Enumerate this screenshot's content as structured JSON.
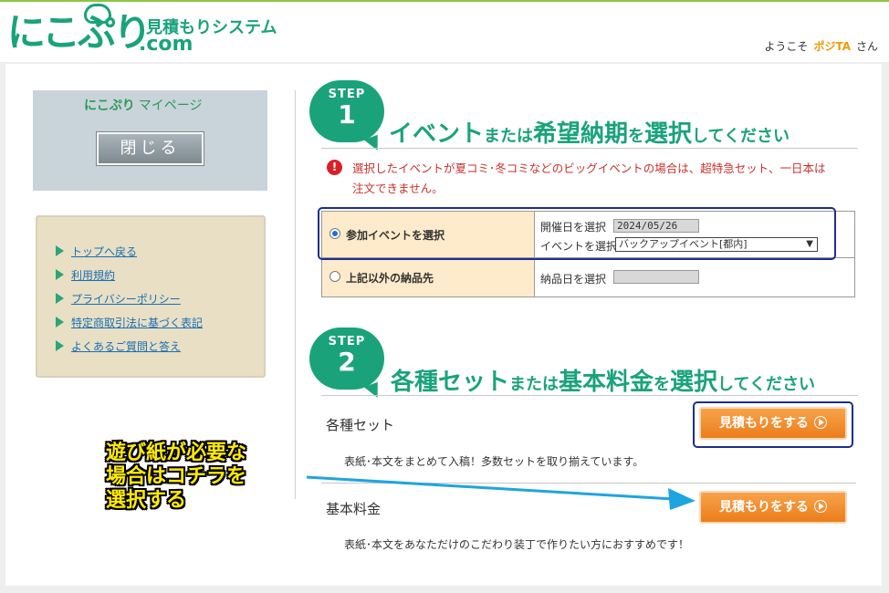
{
  "header": {
    "logo_main": "にこぷり",
    "logo_sub": "見積もりシステム",
    "logo_com": ".com",
    "welcome_prefix": "ようこそ",
    "user_name": "ポジTA",
    "welcome_suffix": "さん"
  },
  "sidebar": {
    "mypage_logo": "にこぷり",
    "mypage_label": "マイページ",
    "close_label": "閉じる",
    "links": [
      "トップへ戻る",
      "利用規約",
      "プライバシーポリシー",
      "特定商取引法に基づく表記",
      "よくあるご質問と答え"
    ]
  },
  "step1": {
    "step_word": "STEP",
    "number": "1",
    "title_a": "イベント",
    "title_b": "または",
    "title_c": "希望納期",
    "title_d": "を",
    "title_e": "選択",
    "title_f": "してください",
    "warning_icon": "exclamation-icon",
    "warning": "選択したイベントが夏コミ･冬コミなどのビッグイベントの場合は、超特急セット、一日本は注文できません。",
    "option_event": "参加イベントを選択",
    "event_date_label": "開催日を選択",
    "event_date_value": "2024/05/26",
    "event_select_label": "イベントを選択",
    "event_select_value": "バックアップイベント[都内]",
    "option_other": "上記以外の納品先",
    "delivery_date_label": "納品日を選択",
    "delivery_date_value": ""
  },
  "step2": {
    "step_word": "STEP",
    "number": "2",
    "title_a": "各種セット",
    "title_b": "または",
    "title_c": "基本料金",
    "title_d": "を",
    "title_e": "選択",
    "title_f": "してください",
    "set_heading": "各種セット",
    "set_button": "見積もりをする",
    "set_desc": "表紙･本文をまとめて入稿！多数セットを取り揃えています。",
    "basic_heading": "基本料金",
    "basic_button": "見積もりをする",
    "basic_desc": "表紙･本文をあなただけのこだわり装丁で作りたい方におすすめです！"
  },
  "annotation": {
    "line1": "遊び紙が必要な",
    "line2": "場合はコチラを",
    "line3": "選択する"
  },
  "colors": {
    "brand_green": "#1aa37a",
    "button_orange": "#ec7d1a",
    "highlight_navy": "#1c2e8f",
    "warning_red": "#c9302c",
    "annotation_yellow": "#ffeb00",
    "arrow_blue": "#1ea5e0"
  }
}
